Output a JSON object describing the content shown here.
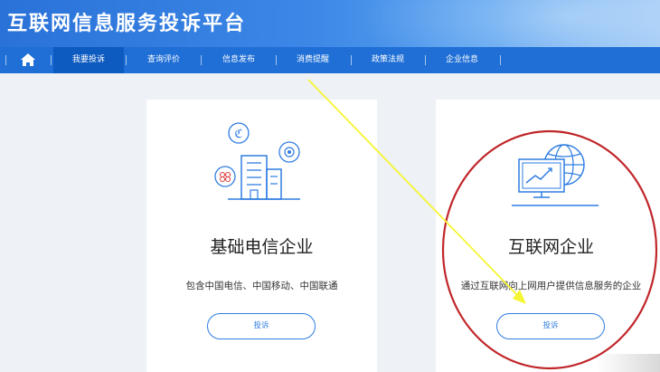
{
  "site": {
    "title": "互联网信息服务投诉平台"
  },
  "nav": {
    "home_icon": "home-icon",
    "items": [
      {
        "label": "我要投诉",
        "active": true
      },
      {
        "label": "查询评价",
        "active": false
      },
      {
        "label": "信息发布",
        "active": false
      },
      {
        "label": "消费提醒",
        "active": false
      },
      {
        "label": "政策法规",
        "active": false
      },
      {
        "label": "企业信息",
        "active": false
      }
    ]
  },
  "cards": [
    {
      "title": "基础电信企业",
      "description": "包含中国电信、中国移动、中国联通",
      "button_label": "投诉",
      "icon": "telecom-buildings-icon"
    },
    {
      "title": "互联网企业",
      "description": "通过互联网向上网用户提供信息服务的企业",
      "button_label": "投诉",
      "icon": "internet-monitor-globe-icon"
    }
  ],
  "colors": {
    "nav_bg": "#1f6fd6",
    "nav_active": "#0d5ac0",
    "accent": "#2f7de1",
    "annotation_arrow": "#f5f532",
    "annotation_circle": "#c0262a"
  }
}
